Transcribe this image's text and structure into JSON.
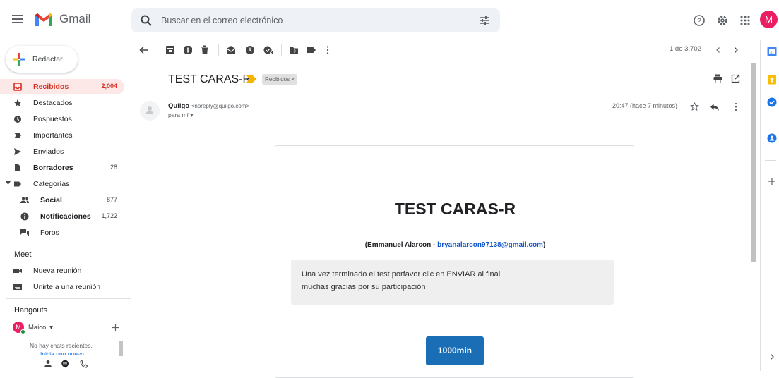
{
  "app": {
    "name": "Gmail",
    "search_placeholder": "Buscar en el correo electrónico",
    "avatar_initial": "M",
    "accent": "#d93025",
    "avatar_color": "#e91e63"
  },
  "compose": {
    "label": "Redactar"
  },
  "sidebar": {
    "items": [
      {
        "label": "Recibidos",
        "count": "2,004",
        "icon": "inbox-icon"
      },
      {
        "label": "Destacados",
        "count": "",
        "icon": "star-icon"
      },
      {
        "label": "Pospuestos",
        "count": "",
        "icon": "clock-icon"
      },
      {
        "label": "Importantes",
        "count": "",
        "icon": "important-icon"
      },
      {
        "label": "Enviados",
        "count": "",
        "icon": "send-icon"
      },
      {
        "label": "Borradores",
        "count": "28",
        "icon": "draft-icon"
      },
      {
        "label": "Categorías",
        "count": "",
        "icon": "label-icon"
      },
      {
        "label": "Social",
        "count": "877",
        "icon": "people-icon"
      },
      {
        "label": "Notificaciones",
        "count": "1,722",
        "icon": "info-icon"
      },
      {
        "label": "Foros",
        "count": "",
        "icon": "forum-icon"
      }
    ],
    "meet": {
      "title": "Meet",
      "items": [
        {
          "label": "Nueva reunión",
          "icon": "video-icon"
        },
        {
          "label": "Unirte a una reunión",
          "icon": "keyboard-icon"
        }
      ]
    },
    "hangouts": {
      "title": "Hangouts",
      "user": "Maicol",
      "user_initial": "M",
      "no_chats": "No hay chats recientes.",
      "start_new": "Inicia uno nuevo"
    }
  },
  "toolbar": {
    "pager": "1 de 3,702"
  },
  "message": {
    "subject": "TEST CARAS-R",
    "label": "Recibidos ×",
    "sender_name": "Quilgo",
    "sender_email": "<noreply@quilgo.com>",
    "to": "para mí",
    "time": "20:47 (hace 7 minutos)"
  },
  "email_body": {
    "title": "TEST CARAS-R",
    "author_prefix": "(Emmanuel Alarcon - ",
    "author_email": "bryanalarcon97138@gmail.com",
    "author_suffix": ")",
    "note_line1": "Una vez terminado el test porfavor clic en ENVIAR al final",
    "note_line2": "muchas gracias por su participación",
    "button": "1000min",
    "button_color": "#1a6eb6"
  }
}
